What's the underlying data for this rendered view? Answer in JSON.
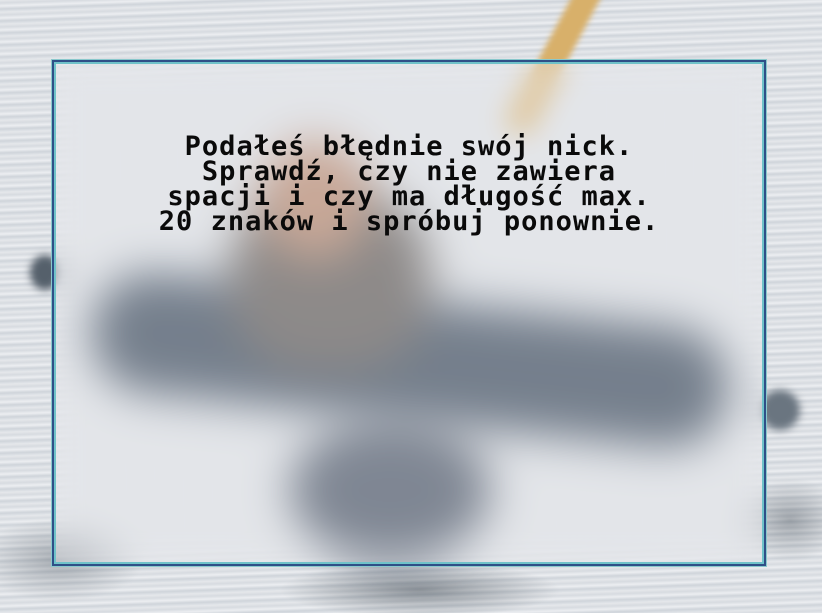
{
  "dialog": {
    "message_lines": [
      "Podałeś błędnie swój nick.",
      "Sprawdź, czy nie zawiera",
      "spacji i czy ma długość max.",
      "20 znaków i spróbuj ponownie."
    ]
  },
  "colors": {
    "panel_border_outer": "#2f4f87",
    "panel_border_inner": "#6fc2c9",
    "message_text": "#0a0a0a"
  }
}
